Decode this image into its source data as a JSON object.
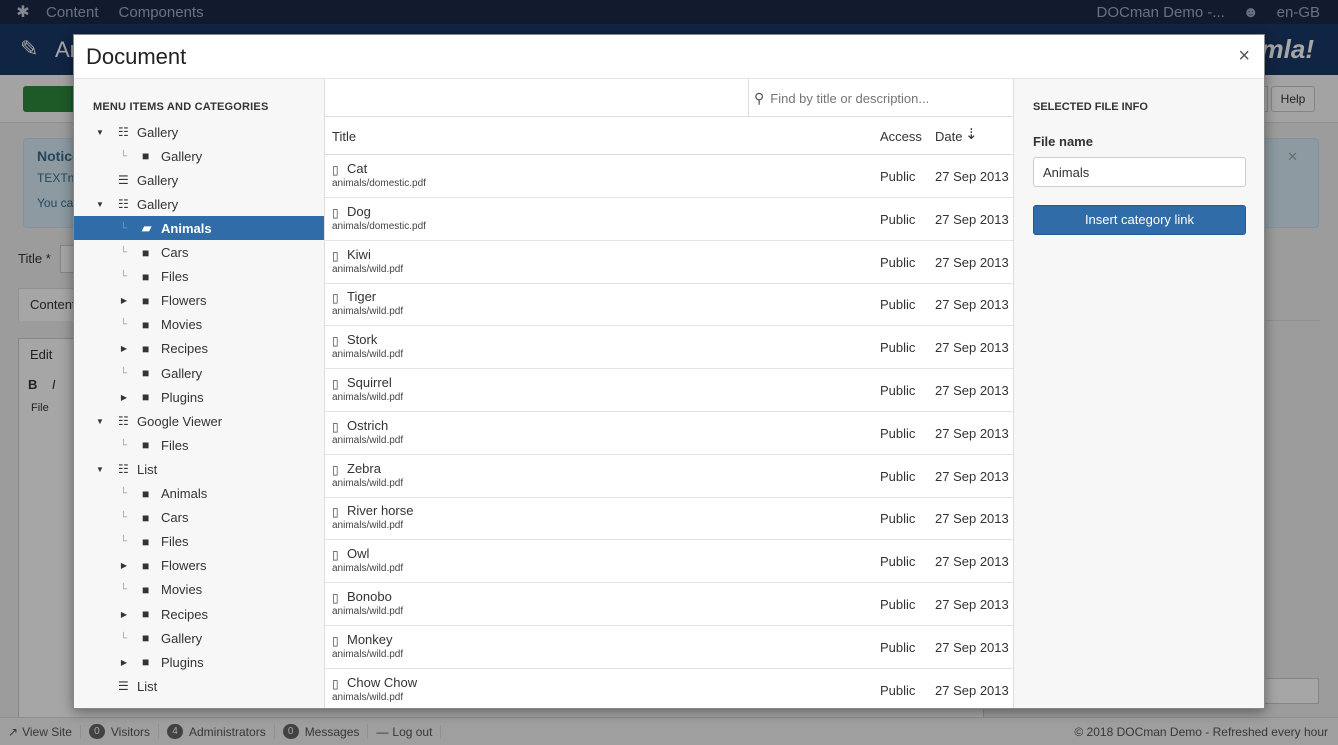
{
  "background": {
    "topbar": {
      "menu": [
        "Content",
        "Components"
      ],
      "site_link": "DOCman Demo -...",
      "language": "en-GB"
    },
    "header": {
      "title": "Art",
      "logo": "Joomla!"
    },
    "toolbar": {
      "help_label": "Help"
    },
    "notice": {
      "heading": "Notice",
      "line1": "TEXTn",
      "line2": "You ca"
    },
    "form": {
      "title_label": "Title *",
      "tab_label": "Content",
      "edit_menu": "Edit",
      "file_button": "File"
    },
    "status": {
      "view_site": "View Site",
      "visitors_count": "0",
      "visitors_label": "Visitors",
      "admins_count": "4",
      "admins_label": "Administrators",
      "messages_count": "0",
      "messages_label": "Messages",
      "logout": "Log out",
      "copyright": "© 2018 DOCman Demo - Refreshed every hour"
    }
  },
  "modal": {
    "title": "Document",
    "close_symbol": "×",
    "tree": {
      "heading": "MENU ITEMS AND CATEGORIES",
      "items": [
        {
          "label": "Gallery",
          "icon": "menu-tree-icon",
          "level": 0,
          "caret": true,
          "active": false
        },
        {
          "label": "Gallery",
          "icon": "folder-icon",
          "level": 1,
          "caret": false,
          "active": false
        },
        {
          "label": "Gallery",
          "icon": "menu-list-icon",
          "level": 0,
          "caret": false,
          "active": false
        },
        {
          "label": "Gallery",
          "icon": "menu-tree-icon",
          "level": 0,
          "caret": true,
          "active": false
        },
        {
          "label": "Animals",
          "icon": "folder-open-icon",
          "level": 1,
          "caret": false,
          "active": true
        },
        {
          "label": "Cars",
          "icon": "folder-icon",
          "level": 1,
          "caret": false,
          "active": false
        },
        {
          "label": "Files",
          "icon": "folder-icon",
          "level": 1,
          "caret": false,
          "active": false
        },
        {
          "label": "Flowers",
          "icon": "folder-icon",
          "level": 1,
          "caret": true,
          "active": false
        },
        {
          "label": "Movies",
          "icon": "folder-icon",
          "level": 1,
          "caret": false,
          "active": false
        },
        {
          "label": "Recipes",
          "icon": "folder-icon",
          "level": 1,
          "caret": true,
          "active": false
        },
        {
          "label": "Gallery",
          "icon": "folder-icon",
          "level": 1,
          "caret": false,
          "active": false
        },
        {
          "label": "Plugins",
          "icon": "folder-icon",
          "level": 1,
          "caret": true,
          "active": false
        },
        {
          "label": "Google Viewer",
          "icon": "menu-tree-icon",
          "level": 0,
          "caret": true,
          "active": false
        },
        {
          "label": "Files",
          "icon": "folder-icon",
          "level": 1,
          "caret": false,
          "active": false
        },
        {
          "label": "List",
          "icon": "menu-tree-icon",
          "level": 0,
          "caret": true,
          "active": false
        },
        {
          "label": "Animals",
          "icon": "folder-icon",
          "level": 1,
          "caret": false,
          "active": false
        },
        {
          "label": "Cars",
          "icon": "folder-icon",
          "level": 1,
          "caret": false,
          "active": false
        },
        {
          "label": "Files",
          "icon": "folder-icon",
          "level": 1,
          "caret": false,
          "active": false
        },
        {
          "label": "Flowers",
          "icon": "folder-icon",
          "level": 1,
          "caret": true,
          "active": false
        },
        {
          "label": "Movies",
          "icon": "folder-icon",
          "level": 1,
          "caret": false,
          "active": false
        },
        {
          "label": "Recipes",
          "icon": "folder-icon",
          "level": 1,
          "caret": true,
          "active": false
        },
        {
          "label": "Gallery",
          "icon": "folder-icon",
          "level": 1,
          "caret": false,
          "active": false
        },
        {
          "label": "Plugins",
          "icon": "folder-icon",
          "level": 1,
          "caret": true,
          "active": false
        },
        {
          "label": "List",
          "icon": "menu-list-icon",
          "level": 0,
          "caret": false,
          "active": false
        }
      ]
    },
    "search": {
      "placeholder": "Find by title or description..."
    },
    "table": {
      "columns": {
        "title": "Title",
        "access": "Access",
        "date": "Date"
      },
      "rows": [
        {
          "name": "Cat",
          "path": "animals/domestic.pdf",
          "access": "Public",
          "date": "27 Sep 2013"
        },
        {
          "name": "Dog",
          "path": "animals/domestic.pdf",
          "access": "Public",
          "date": "27 Sep 2013"
        },
        {
          "name": "Kiwi",
          "path": "animals/wild.pdf",
          "access": "Public",
          "date": "27 Sep 2013"
        },
        {
          "name": "Tiger",
          "path": "animals/wild.pdf",
          "access": "Public",
          "date": "27 Sep 2013"
        },
        {
          "name": "Stork",
          "path": "animals/wild.pdf",
          "access": "Public",
          "date": "27 Sep 2013"
        },
        {
          "name": "Squirrel",
          "path": "animals/wild.pdf",
          "access": "Public",
          "date": "27 Sep 2013"
        },
        {
          "name": "Ostrich",
          "path": "animals/wild.pdf",
          "access": "Public",
          "date": "27 Sep 2013"
        },
        {
          "name": "Zebra",
          "path": "animals/wild.pdf",
          "access": "Public",
          "date": "27 Sep 2013"
        },
        {
          "name": "River horse",
          "path": "animals/wild.pdf",
          "access": "Public",
          "date": "27 Sep 2013"
        },
        {
          "name": "Owl",
          "path": "animals/wild.pdf",
          "access": "Public",
          "date": "27 Sep 2013"
        },
        {
          "name": "Bonobo",
          "path": "animals/wild.pdf",
          "access": "Public",
          "date": "27 Sep 2013"
        },
        {
          "name": "Monkey",
          "path": "animals/wild.pdf",
          "access": "Public",
          "date": "27 Sep 2013"
        },
        {
          "name": "Chow Chow",
          "path": "animals/wild.pdf",
          "access": "Public",
          "date": "27 Sep 2013"
        }
      ]
    },
    "info": {
      "heading": "SELECTED FILE INFO",
      "file_name_label": "File name",
      "file_name_value": "Animals",
      "insert_button": "Insert category link"
    }
  },
  "colors": {
    "accent": "#2f6ca8",
    "header": "#1a3867",
    "topbar": "#1b2a45",
    "save": "#2f8a3c"
  }
}
